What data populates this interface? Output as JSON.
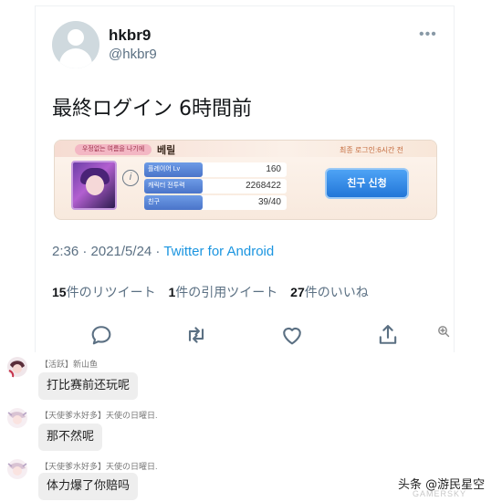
{
  "tweet": {
    "display_name": "hkbr9",
    "handle": "@hkbr9",
    "more": "•••",
    "text": "最終ログイン 6時間前",
    "timestamp": "2:36 · 2021/5/24 · ",
    "source": "Twitter for Android",
    "stats": {
      "retweets_count": "15",
      "retweets_label": "件のリツイート",
      "quotes_count": "1",
      "quotes_label": "件の引用ツイート",
      "likes_count": "27",
      "likes_label": "件のいいね"
    }
  },
  "game_card": {
    "tag": "우정없는 여름을 나기에",
    "player_name": "베릴",
    "last_login": "최종 로그인:6시간 전",
    "info": "i",
    "stats": [
      {
        "label": "플레이어 Lv",
        "value": "160"
      },
      {
        "label": "캐릭터 전투력",
        "value": "2268422"
      },
      {
        "label": "친구",
        "value": "39/40"
      }
    ],
    "friend_button": "친구 신청"
  },
  "comments": [
    {
      "role": "【活跃】",
      "name": "新山鱼",
      "text": "打比赛前还玩呢"
    },
    {
      "role": "【天使爹水好多】",
      "name": "天使の日曜日.",
      "text": "那不然呢"
    },
    {
      "role": "【天使爹水好多】",
      "name": "天使の日曜日.",
      "text": "体力爆了你赔吗"
    }
  ],
  "watermark": {
    "main": "头条 @游民星空",
    "sub": "GAMERSKY"
  }
}
